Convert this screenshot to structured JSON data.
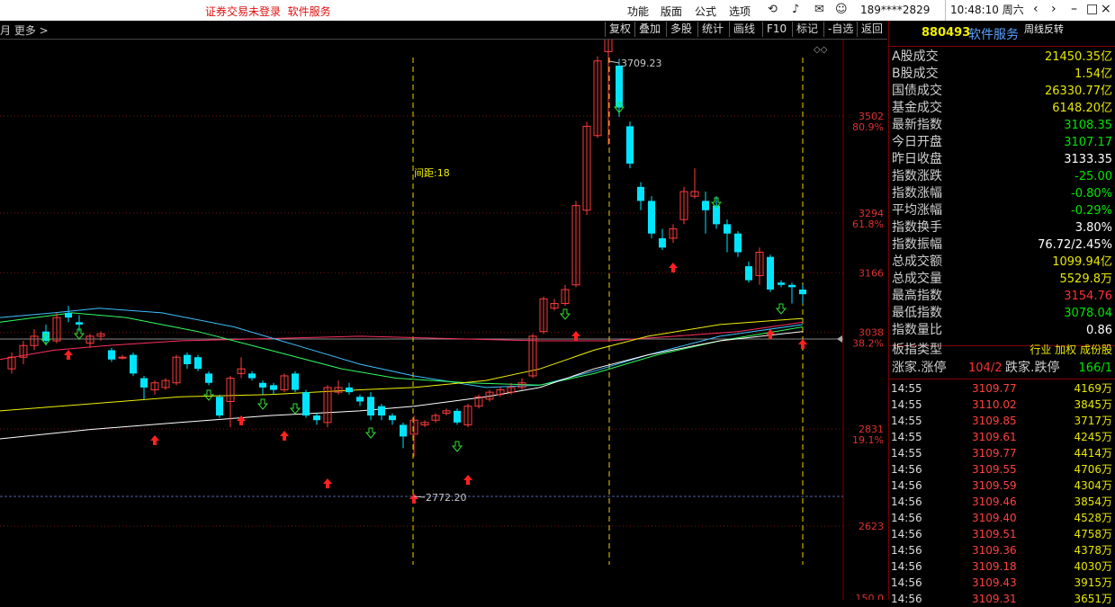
{
  "titlebar": {
    "warning": "证券交易未登录",
    "service": "软件服务",
    "menus": [
      "功能",
      "版面",
      "公式",
      "选项"
    ],
    "user": "189****2829",
    "clock": "10:48:10 周六",
    "win_buttons": [
      "‹",
      "›",
      "–",
      "□",
      "×"
    ]
  },
  "toolbar": {
    "crumb": "月 更多 >",
    "buttons": [
      "复权",
      "叠加",
      "多股",
      "统计",
      "画线",
      "F10",
      "标记",
      "-自选",
      "返回"
    ]
  },
  "chart": {
    "annotations": {
      "high": "3709.23",
      "low": "2772.20",
      "interval": "间距:18"
    },
    "axis_labels": [
      {
        "value": "3502",
        "pct": "80.9%"
      },
      {
        "value": "3294",
        "pct": "61.8%"
      },
      {
        "value": "3166",
        "pct": ""
      },
      {
        "value": "3038",
        "pct": "38.2%"
      },
      {
        "value": "2831",
        "pct": "19.1%"
      },
      {
        "value": "2623",
        "pct": ""
      },
      {
        "value": "150.0",
        "pct": ""
      }
    ],
    "colors": {
      "up": "#ff3c3c",
      "down": "#00e5ff",
      "ma1": "#ffffff",
      "ma2": "#f0f000",
      "ma3": "#ff3060",
      "ma4": "#30ff60",
      "ma5": "#3fc0ff"
    }
  },
  "panel": {
    "code": "880493",
    "name": "软件服务",
    "tag": "周线反转",
    "rows": [
      {
        "k": "A股成交",
        "v": "21450.35亿",
        "c": ""
      },
      {
        "k": "B股成交",
        "v": "1.54亿",
        "c": ""
      },
      {
        "k": "国债成交",
        "v": "26330.77亿",
        "c": ""
      },
      {
        "k": "基金成交",
        "v": "6148.20亿",
        "c": ""
      },
      {
        "k": "最新指数",
        "v": "3108.35",
        "c": "green"
      },
      {
        "k": "今日开盘",
        "v": "3107.17",
        "c": "green"
      },
      {
        "k": "昨日收盘",
        "v": "3133.35",
        "c": "white"
      },
      {
        "k": "指数涨跌",
        "v": "-25.00",
        "c": "green"
      },
      {
        "k": "指数涨幅",
        "v": "-0.80%",
        "c": "green"
      },
      {
        "k": "平均涨幅",
        "v": "-0.29%",
        "c": "green"
      },
      {
        "k": "指数换手",
        "v": "3.80%",
        "c": "white"
      },
      {
        "k": "指数振幅",
        "v": "76.72/2.45%",
        "c": "white"
      },
      {
        "k": "总成交额",
        "v": "1099.94亿",
        "c": ""
      },
      {
        "k": "总成交量",
        "v": "5529.8万",
        "c": ""
      },
      {
        "k": "最高指数",
        "v": "3154.76",
        "c": "red"
      },
      {
        "k": "最低指数",
        "v": "3078.04",
        "c": "green"
      },
      {
        "k": "指数量比",
        "v": "0.86",
        "c": "white"
      }
    ],
    "board_type": {
      "k": "板指类型",
      "v": "行业 加权 成份股"
    },
    "updown": {
      "k1": "涨家.涨停",
      "v1": "104/2",
      "k2": "跌家.跌停",
      "v2": "166/1"
    },
    "ticks": [
      {
        "t": "14:55",
        "p": "3109.77",
        "v": "4169万"
      },
      {
        "t": "14:55",
        "p": "3110.02",
        "v": "3845万"
      },
      {
        "t": "14:55",
        "p": "3109.85",
        "v": "3717万"
      },
      {
        "t": "14:55",
        "p": "3109.61",
        "v": "4245万"
      },
      {
        "t": "14:55",
        "p": "3109.77",
        "v": "4414万"
      },
      {
        "t": "14:56",
        "p": "3109.55",
        "v": "4706万"
      },
      {
        "t": "14:56",
        "p": "3109.59",
        "v": "4304万"
      },
      {
        "t": "14:56",
        "p": "3109.46",
        "v": "3854万"
      },
      {
        "t": "14:56",
        "p": "3109.40",
        "v": "4528万"
      },
      {
        "t": "14:56",
        "p": "3109.51",
        "v": "4758万"
      },
      {
        "t": "14:56",
        "p": "3109.36",
        "v": "4378万"
      },
      {
        "t": "14:56",
        "p": "3109.18",
        "v": "4030万"
      },
      {
        "t": "14:56",
        "p": "3109.43",
        "v": "3915万"
      },
      {
        "t": "14:56",
        "p": "3109.31",
        "v": "3651万"
      }
    ]
  }
}
